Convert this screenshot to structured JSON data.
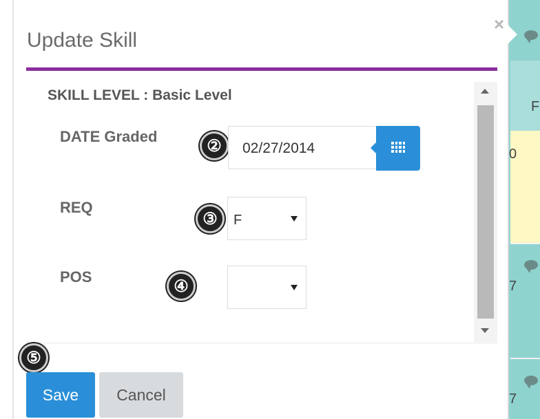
{
  "dialog": {
    "title": "Update Skill",
    "close_glyph": "×",
    "skill_level": "SKILL LEVEL : Basic Level"
  },
  "fields": {
    "date_label": "DATE Graded",
    "date_value": "02/27/2014",
    "req_label": "REQ",
    "req_value": "F",
    "pos_label": "POS",
    "pos_value": ""
  },
  "badges": [
    "②",
    "③",
    "④",
    "⑤"
  ],
  "buttons": {
    "save": "Save",
    "cancel": "Cancel"
  },
  "background": {
    "cell_letter": "F",
    "partial_0": "0",
    "partial_7a": "7",
    "partial_7b": "7"
  },
  "colors": {
    "accent_rule": "#8b2e9b",
    "primary_button": "#2a8fd8",
    "background_teal": "#8fd3cf",
    "background_yellow": "#fdf8c4"
  },
  "icons": [
    "close-icon",
    "calendar-icon",
    "chevron-down-icon",
    "scroll-up-icon",
    "scroll-down-icon",
    "comment-icon"
  ]
}
